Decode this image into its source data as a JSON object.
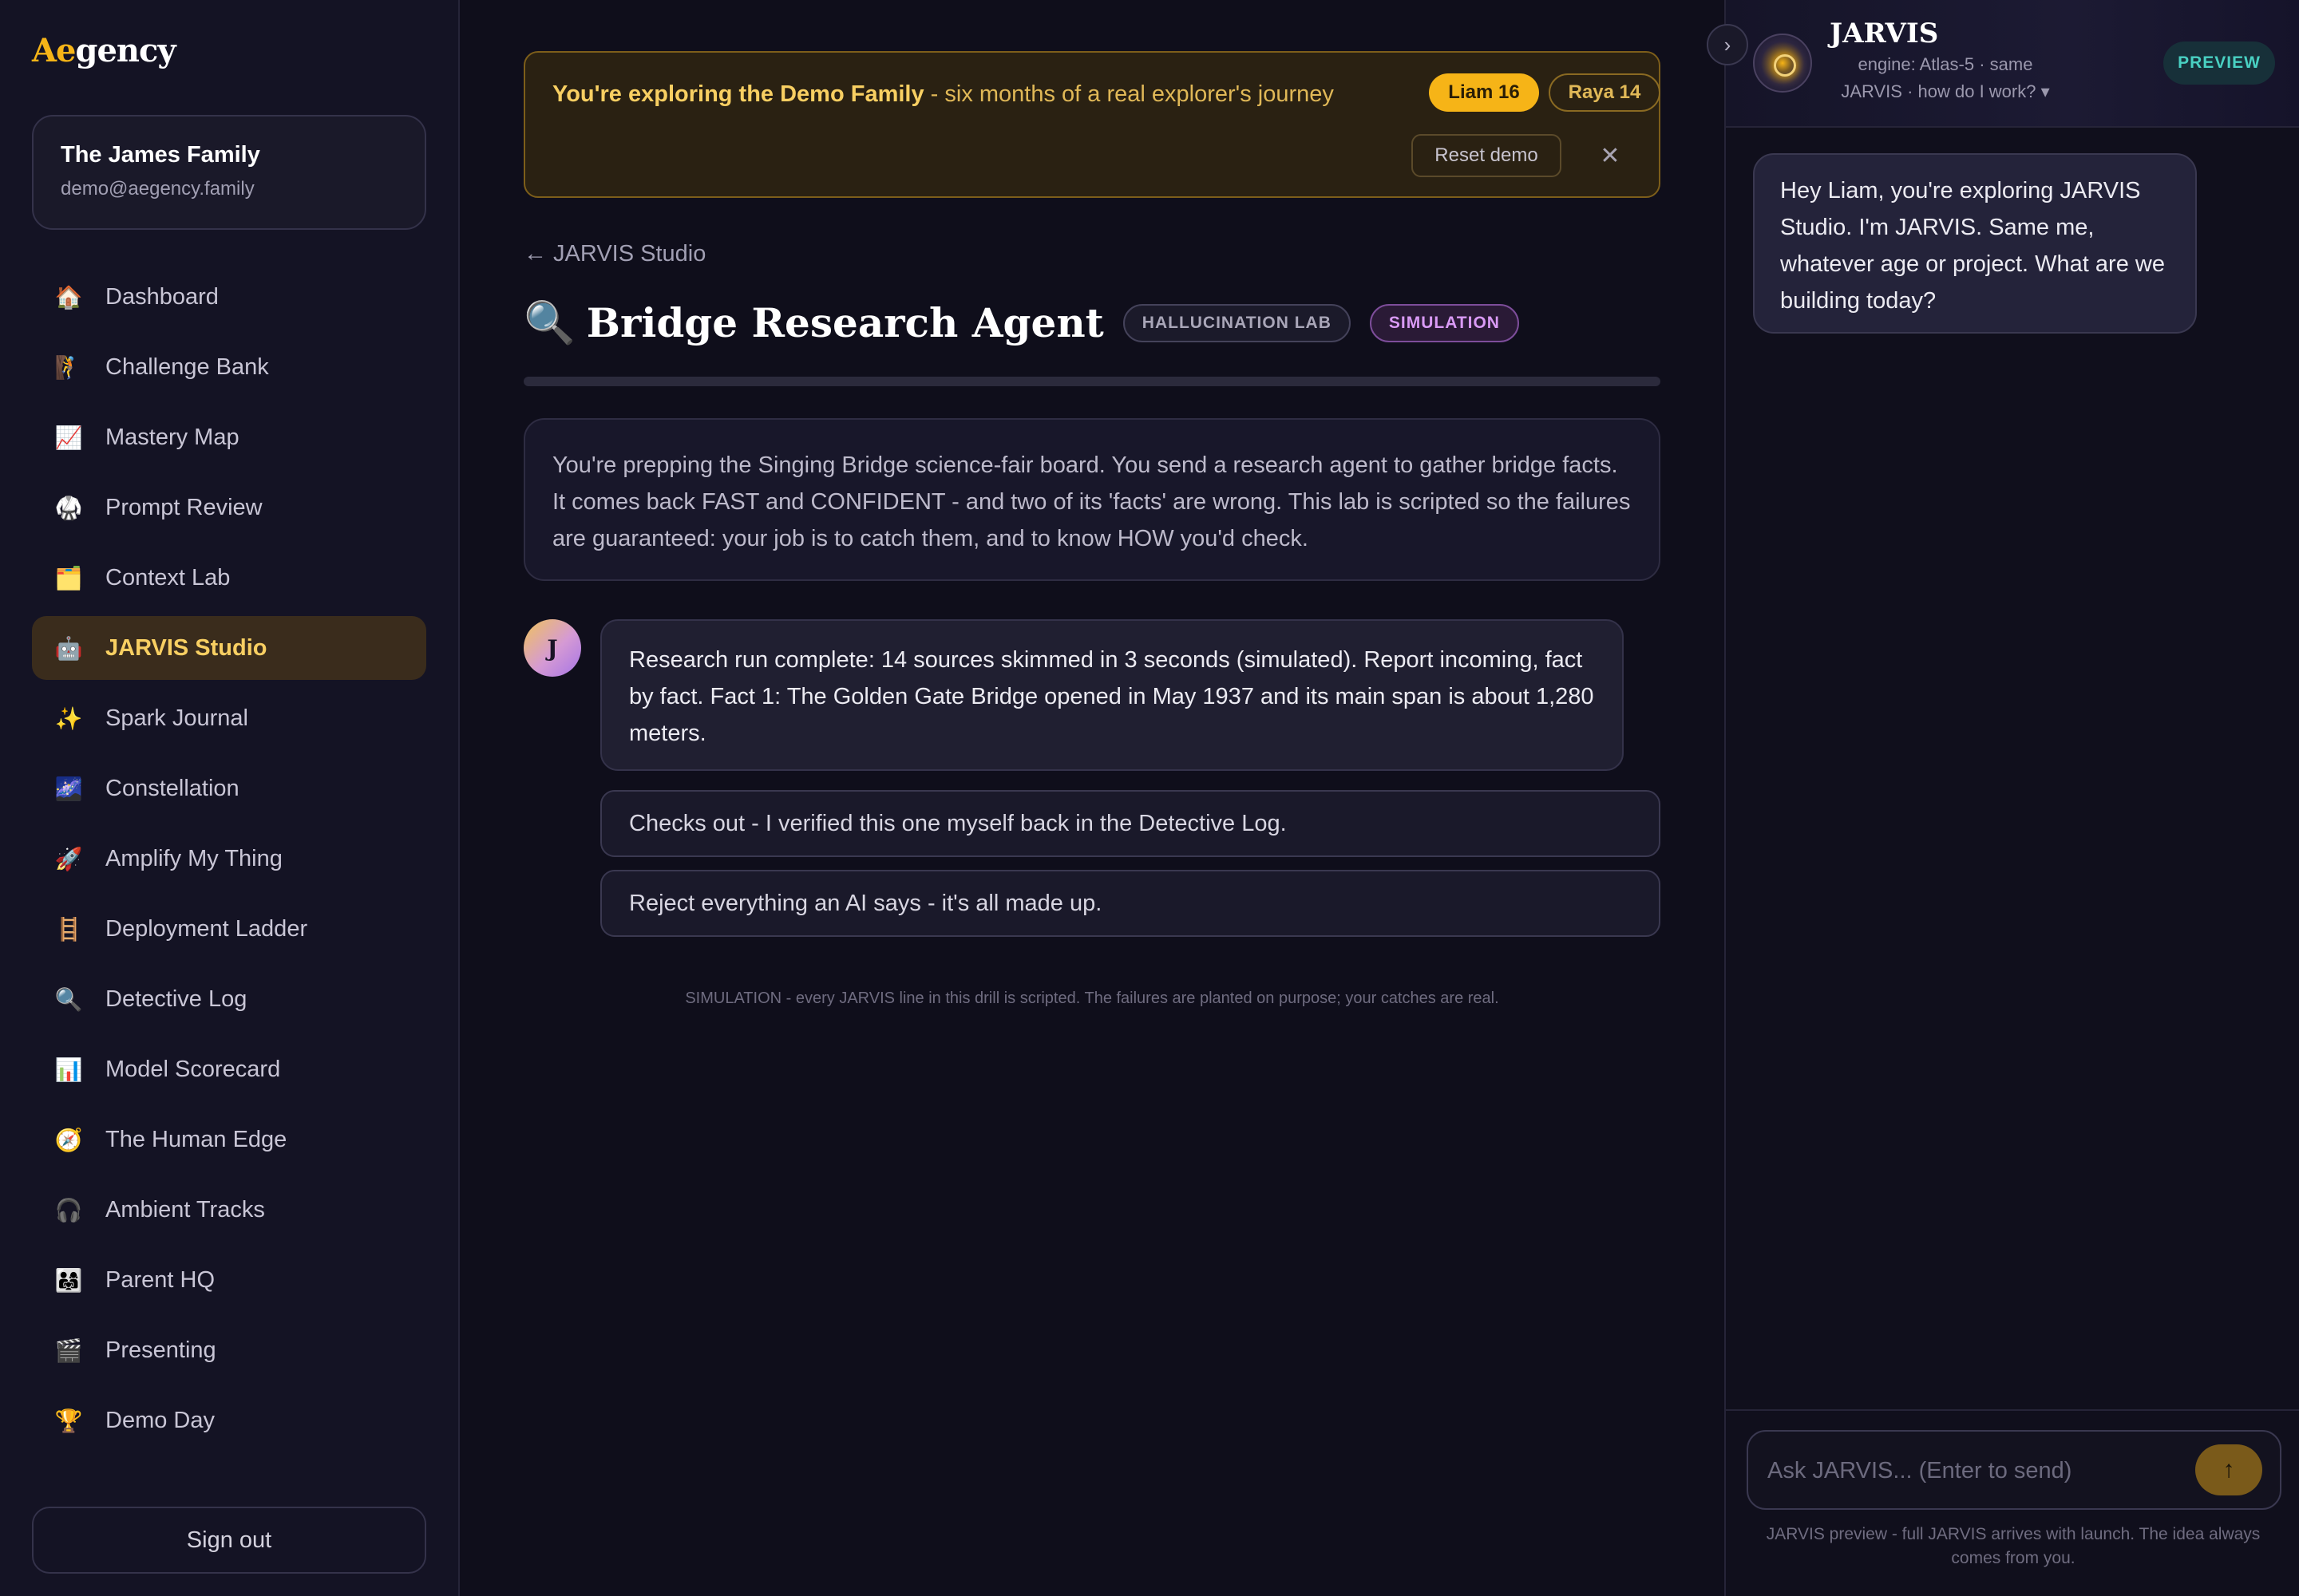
{
  "app": {
    "logo_prefix": "Ae",
    "logo_suffix": "gency",
    "accent": "#f6b417"
  },
  "account": {
    "family_name": "The James Family",
    "email": "demo@aegency.family"
  },
  "sidebar": {
    "items": [
      {
        "icon": "🏠",
        "icon_name": "house-icon",
        "label": "Dashboard"
      },
      {
        "icon": "🧗",
        "icon_name": "climber-icon",
        "label": "Challenge Bank"
      },
      {
        "icon": "📈",
        "icon_name": "chart-increasing-icon",
        "label": "Mastery Map"
      },
      {
        "icon": "🥋",
        "icon_name": "martial-arts-icon",
        "label": "Prompt Review"
      },
      {
        "icon": "🗂️",
        "icon_name": "card-index-dividers-icon",
        "label": "Context Lab"
      },
      {
        "icon": "🤖",
        "icon_name": "robot-icon",
        "label": "JARVIS Studio",
        "active": true
      },
      {
        "icon": "✨",
        "icon_name": "sparkles-icon",
        "label": "Spark Journal"
      },
      {
        "icon": "🌌",
        "icon_name": "milky-way-icon",
        "label": "Constellation"
      },
      {
        "icon": "🚀",
        "icon_name": "rocket-icon",
        "label": "Amplify My Thing"
      },
      {
        "icon": "🪜",
        "icon_name": "ladder-icon",
        "label": "Deployment Ladder"
      },
      {
        "icon": "🔍",
        "icon_name": "magnifier-icon",
        "label": "Detective Log"
      },
      {
        "icon": "📊",
        "icon_name": "bar-chart-icon",
        "label": "Model Scorecard"
      },
      {
        "icon": "🧭",
        "icon_name": "compass-icon",
        "label": "The Human Edge"
      },
      {
        "icon": "🎧",
        "icon_name": "headphones-icon",
        "label": "Ambient Tracks"
      },
      {
        "icon": "👨‍👩‍👧",
        "icon_name": "family-icon",
        "label": "Parent HQ"
      },
      {
        "icon": "🎬",
        "icon_name": "clapper-board-icon",
        "label": "Presenting"
      },
      {
        "icon": "🏆",
        "icon_name": "trophy-icon",
        "label": "Demo Day"
      }
    ],
    "signout_label": "Sign out"
  },
  "banner": {
    "strong": "You're exploring the Demo Family",
    "rest": " - six months of a real explorer's journey",
    "kids": [
      "Liam 16",
      "Raya 14"
    ],
    "reset_label": "Reset demo",
    "close_glyph": "✕"
  },
  "page": {
    "back_link": "← JARVIS Studio",
    "title_icon": "🔍",
    "title": "Bridge Research Agent",
    "badges": [
      "HALLUCINATION LAB",
      "SIMULATION"
    ],
    "progress": 0,
    "intro": "You're prepping the Singing Bridge science-fair board. You send a research agent to gather bridge facts. It comes back FAST and CONFIDENT - and two of its 'facts' are wrong. This lab is scripted so the failures are guaranteed: your job is to catch them, and to know HOW you'd check.",
    "avatar_letter": "J",
    "message": "Research run complete: 14 sources skimmed in 3 seconds (simulated). Report incoming, fact by fact. Fact 1: The Golden Gate Bridge opened in May 1937 and its main span is about 1,280 meters.",
    "choices": [
      "Checks out - I verified this one myself back in the Detective Log.",
      "Reject everything an AI says - it's all made up."
    ],
    "footnote": "SIMULATION - every JARVIS line in this drill is scripted. The failures are planted on purpose; your catches are real."
  },
  "jarvis": {
    "collapse_glyph": "›",
    "name": "JARVIS",
    "engine": "engine: Atlas-5 · same JARVIS · how do I work? ▾",
    "preview_label": "PREVIEW",
    "greeting": "Hey Liam, you're exploring JARVIS Studio. I'm JARVIS. Same me, whatever age or project. What are we building today?",
    "input_placeholder": "Ask JARVIS... (Enter to send)",
    "send_glyph": "↑",
    "footer": "JARVIS preview - full JARVIS arrives with launch. The idea always comes from you."
  }
}
